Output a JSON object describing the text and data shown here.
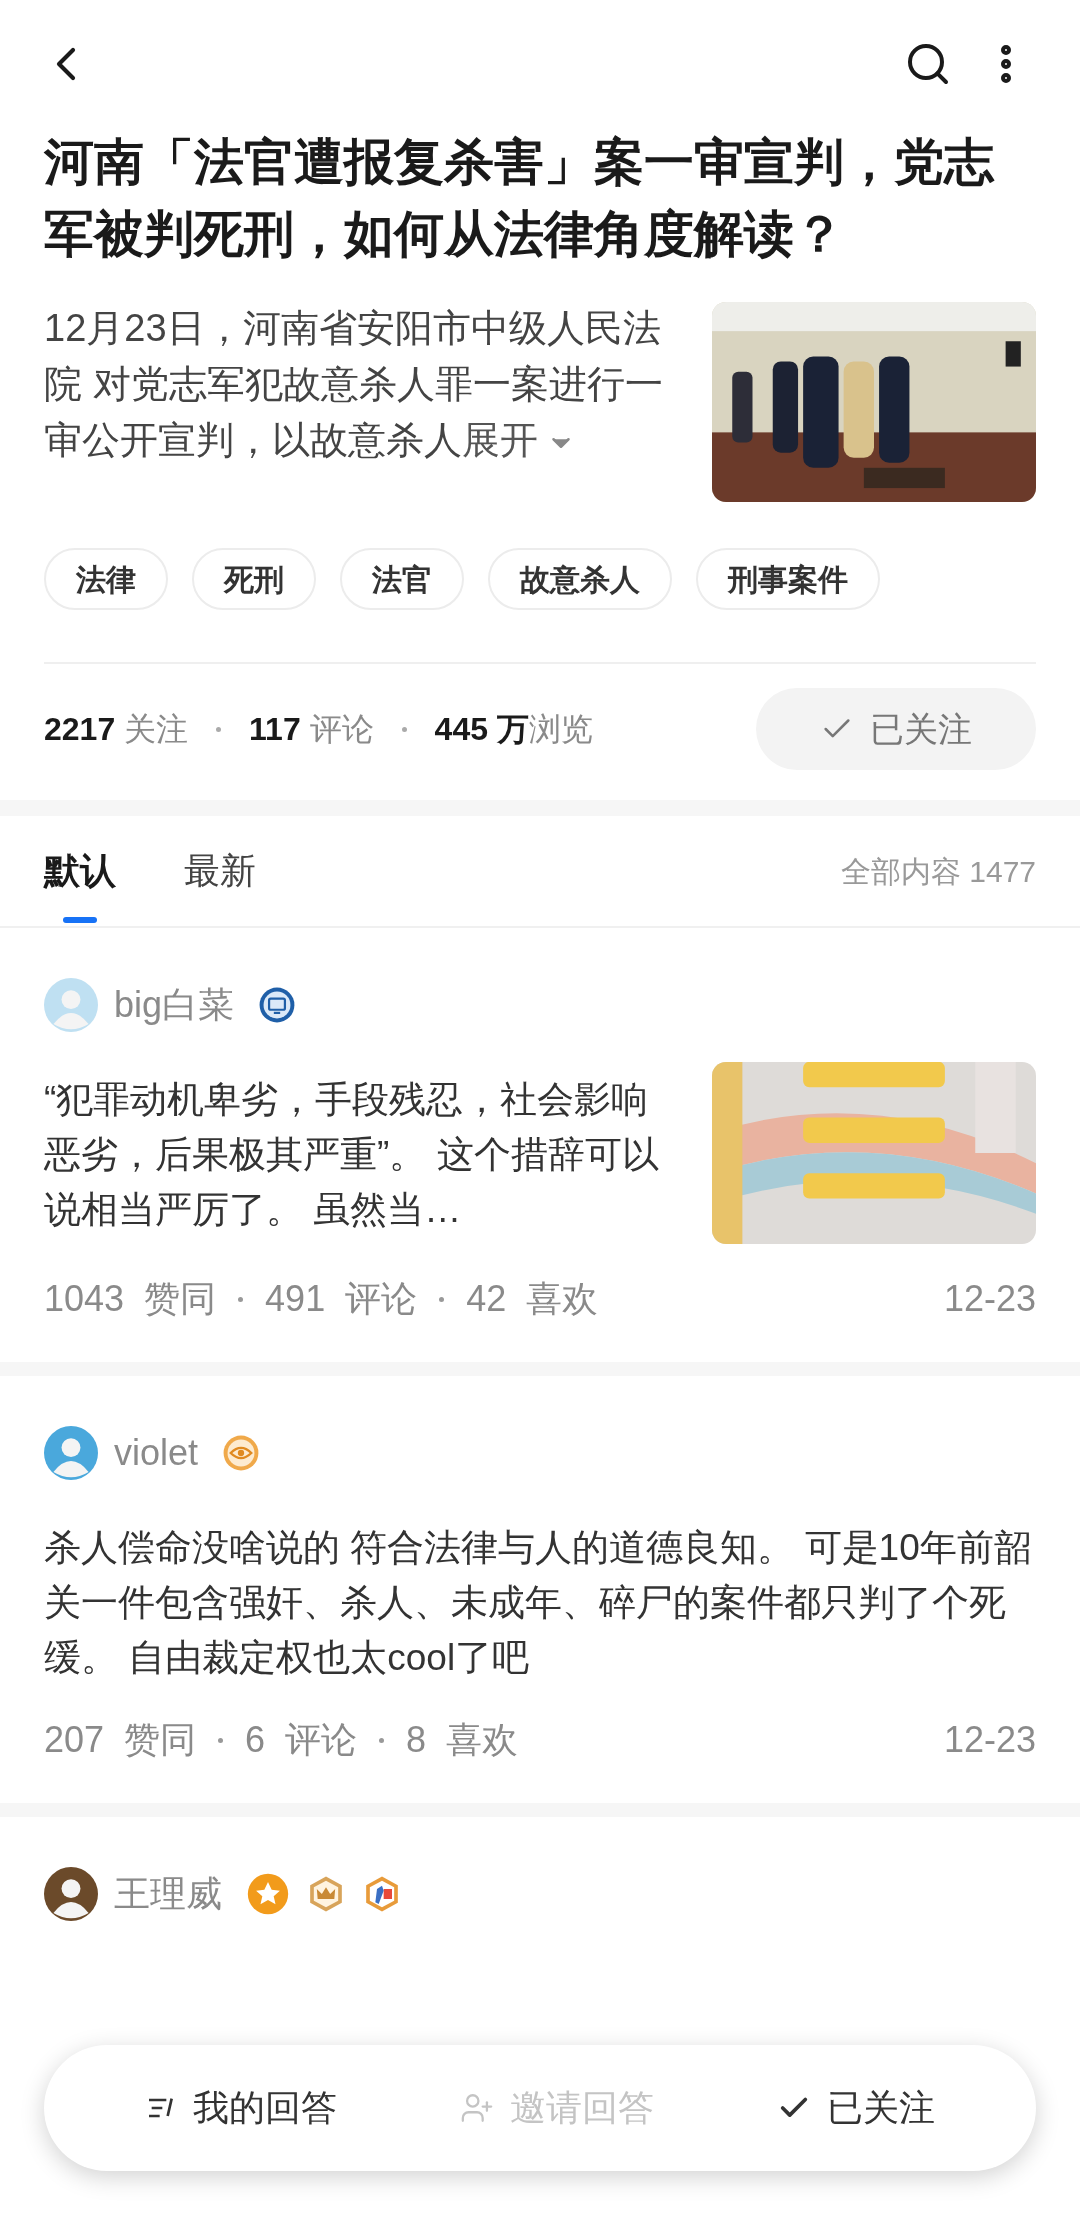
{
  "question": {
    "title": "河南「法官遭报复杀害」案一审宣判，党志军被判死刑，如何从法律角度解读？",
    "excerpt": "12月23日，河南省安阳市中级人民法院 对党志军犯故意杀人罪一案进行一审公开宣判，以故意杀人",
    "expand": "展开",
    "image": {
      "kind": "picture"
    }
  },
  "tags": [
    "法律",
    "死刑",
    "法官",
    "故意杀人",
    "刑事案件"
  ],
  "stats": [
    "**2217** 关注",
    "**117** 评论",
    "**445 万**浏览"
  ],
  "follow_button": {
    "label": "已关注",
    "followed": true
  },
  "tabs": [
    {
      "label": "默认",
      "selected": true
    },
    {
      "label": "最新",
      "selected": false
    }
  ],
  "total": "全部内容 1477",
  "answers": [
    {
      "author": "big白菜",
      "badges": [
        {
          "kind": "monitor"
        }
      ],
      "text": "“犯罪动机卑劣，手段残忍，社会影响恶劣，后果极其严重”。 这个措辞可以说相当严厉了。 虽然当…",
      "image": {
        "kind": "picture"
      },
      "stats": [
        "1043  赞同",
        "491  评论",
        "42  喜欢"
      ],
      "date": "12-23"
    },
    {
      "author": "violet",
      "badges": [
        {
          "kind": "eye"
        }
      ],
      "text": "杀人偿命没啥说的 符合法律与人的道德良知。 可是10年前韶关一件包含强奸、杀人、未成年、碎尸的案件都只判了个死缓。 自由裁定权也太cool了吧",
      "stats": [
        "207  赞同",
        "6  评论",
        "8  喜欢"
      ],
      "date": "12-23"
    },
    {
      "author": "王理威",
      "badges": [
        {
          "kind": "star"
        },
        {
          "kind": "crown"
        },
        {
          "kind": "pen"
        }
      ]
    }
  ],
  "bottom_bar": [
    {
      "kind": "answer",
      "label": "我的回答",
      "disabled": false
    },
    {
      "kind": "invite",
      "label": "邀请回答",
      "disabled": true
    },
    {
      "kind": "follow",
      "label": "已关注",
      "disabled": false
    }
  ]
}
